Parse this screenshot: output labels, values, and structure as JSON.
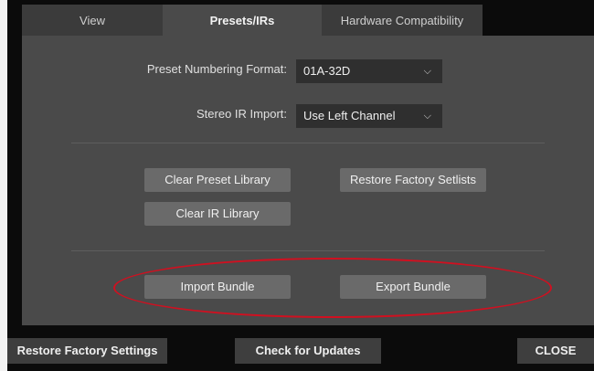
{
  "tabs": {
    "view": "View",
    "presets": "Presets/IRs",
    "hardware": "Hardware Compatibility"
  },
  "settings": {
    "preset_numbering_label": "Preset Numbering Format:",
    "preset_numbering_value": "01A-32D",
    "stereo_ir_label": "Stereo IR Import:",
    "stereo_ir_value": "Use Left Channel"
  },
  "buttons": {
    "clear_preset_library": "Clear Preset Library",
    "restore_factory_setlists": "Restore Factory Setlists",
    "clear_ir_library": "Clear IR Library",
    "import_bundle": "Import Bundle",
    "export_bundle": "Export Bundle"
  },
  "footer": {
    "restore_factory_settings": "Restore Factory Settings",
    "check_for_updates": "Check for Updates",
    "close": "CLOSE"
  },
  "colors": {
    "highlight_ellipse": "#d01020"
  },
  "icons": {
    "dropdown": "chevron-down-icon"
  }
}
